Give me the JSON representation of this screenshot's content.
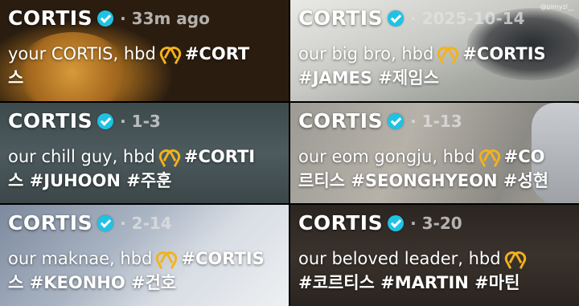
{
  "tiles": [
    {
      "name": "CORTIS",
      "meta": "· 33m ago",
      "line1": "your CORTIS, hbd",
      "tag1": "#CORT",
      "line2": "스"
    },
    {
      "name": "CORTIS",
      "meta": "· 2025-10-14",
      "line1": "our big bro, hbd",
      "tag1": "#CORTIS",
      "line2": "#JAMES #제임스",
      "watermark": "@pimyzi__"
    },
    {
      "name": "CORTIS",
      "meta": "· 1-3",
      "line1": "our chill guy, hbd",
      "tag1": "#CORTI",
      "line2": "스 #JUHOON #주훈"
    },
    {
      "name": "CORTIS",
      "meta": "· 1-13",
      "line1": "our eom gongju, hbd",
      "tag1": "#CO",
      "line2": "르티스 #SEONGHYEON #성현"
    },
    {
      "name": "CORTIS",
      "meta": "· 2-14",
      "line1": "our maknae, hbd",
      "tag1": "#CORTIS",
      "line2": "스 #KEONHO #건호"
    },
    {
      "name": "CORTIS",
      "meta": "· 3-20",
      "line1": "our beloved leader, hbd",
      "tag1": "",
      "line2": "#코르티스 #MARTIN #마틴"
    }
  ],
  "icons": {
    "verified": "verified-check-icon",
    "heart_hands": "heart-hands-icon"
  },
  "colors": {
    "verified": "#20c2e3",
    "heart": "#f3b21b"
  }
}
